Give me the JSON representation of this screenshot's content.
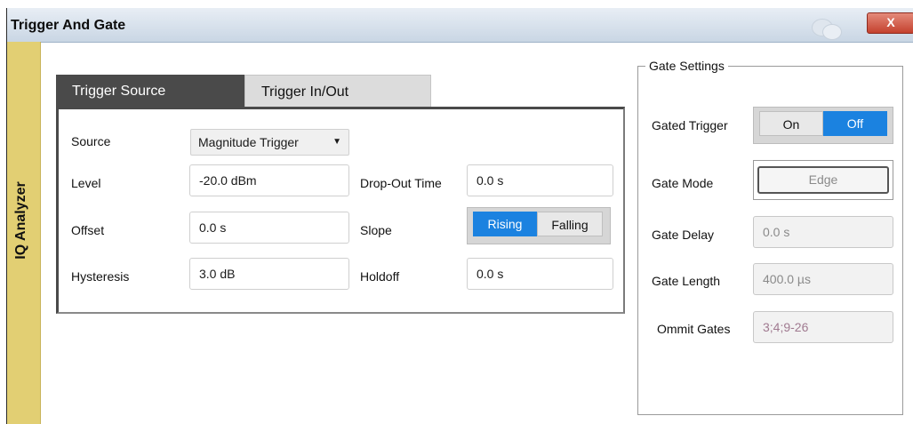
{
  "window": {
    "title": "Trigger And Gate",
    "close_label": "X",
    "side_tab": "IQ Analyzer"
  },
  "tabs": [
    {
      "label": "Trigger Source",
      "active": true
    },
    {
      "label": "Trigger In/Out",
      "active": false
    }
  ],
  "trigger": {
    "source_label": "Source",
    "source_value": "Magnitude Trigger",
    "source_arrow": "▼",
    "level_label": "Level",
    "level_value": "-20.0 dBm",
    "offset_label": "Offset",
    "offset_value": "0.0 s",
    "hysteresis_label": "Hysteresis",
    "hysteresis_value": "3.0 dB",
    "dropout_label": "Drop-Out Time",
    "dropout_value": "0.0 s",
    "slope_label": "Slope",
    "slope_options": [
      "Rising",
      "Falling"
    ],
    "slope_selected": "Rising",
    "holdoff_label": "Holdoff",
    "holdoff_value": "0.0 s"
  },
  "gate": {
    "group_title": "Gate Settings",
    "gated_trigger_label": "Gated Trigger",
    "gated_trigger_options": [
      "On",
      "Off"
    ],
    "gated_trigger_selected": "Off",
    "gate_mode_label": "Gate Mode",
    "gate_mode_value": "Edge",
    "gate_delay_label": "Gate Delay",
    "gate_delay_value": "0.0 s",
    "gate_length_label": "Gate Length",
    "gate_length_value": "400.0 µs",
    "omit_gates_label": "Ommit Gates",
    "omit_gates_value": "3;4;9-26"
  },
  "colors": {
    "accent": "#1b82e0",
    "side_tab": "#e2cf73",
    "active_tab": "#4a4a4a",
    "close_button": "#c4412e"
  }
}
